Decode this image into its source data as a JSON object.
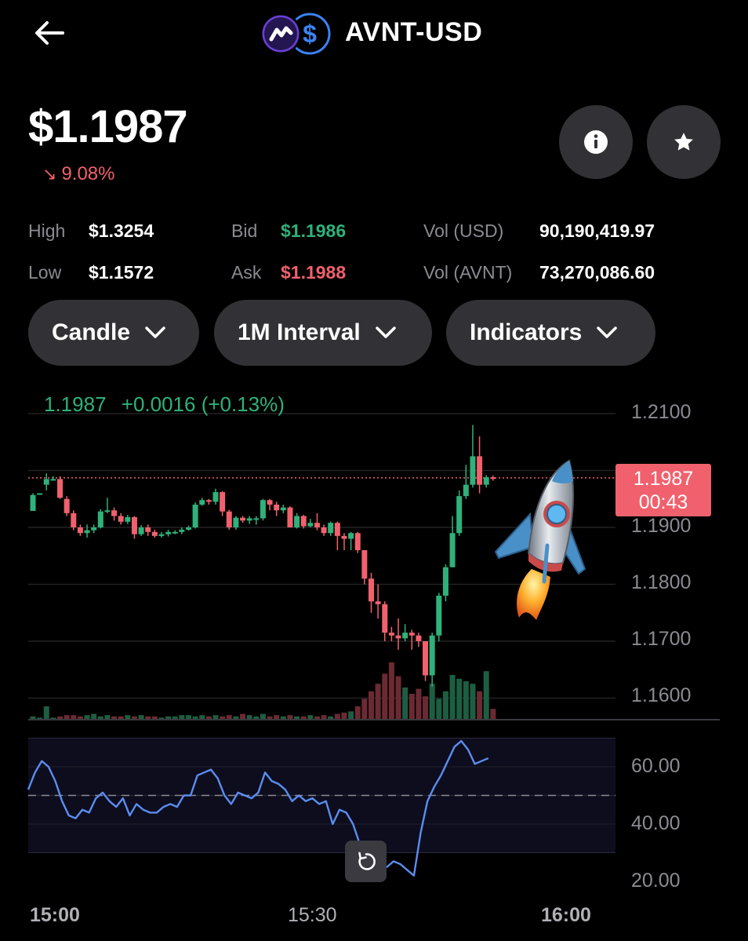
{
  "header": {
    "back_icon": "back-arrow-icon",
    "pair_title": "AVNT-USD",
    "base_icon": "avnt-logo-icon",
    "quote_icon": "usd-logo-icon"
  },
  "price": {
    "value": "$1.1987",
    "change": "9.08%",
    "change_direction_icon": "arrow-down-right-icon",
    "change_color": "#f0616d"
  },
  "actions": {
    "info_icon": "info-icon",
    "favorite_icon": "star-icon"
  },
  "stats": {
    "high_label": "High",
    "high_value": "$1.3254",
    "low_label": "Low",
    "low_value": "$1.1572",
    "bid_label": "Bid",
    "bid_value": "$1.1986",
    "ask_label": "Ask",
    "ask_value": "$1.1988",
    "vol_usd_label": "Vol (USD)",
    "vol_usd_value": "90,190,419.97",
    "vol_avnt_label": "Vol (AVNT)",
    "vol_avnt_value": "73,270,086.60"
  },
  "controls": {
    "chart_type": "Candle",
    "interval": "1M Interval",
    "indicators": "Indicators"
  },
  "chart": {
    "readout_price": "1.1987",
    "readout_change": "+0.0016 (+0.13%)",
    "price_tag_value": "1.1987",
    "price_tag_timer": "00:43",
    "price_axis": [
      "1.2100",
      "1.1900",
      "1.1800",
      "1.1700",
      "1.1600"
    ],
    "rsi_axis": [
      "60.00",
      "40.00",
      "20.00"
    ],
    "time_axis": [
      "15:00",
      "15:30",
      "16:00"
    ],
    "up_color": "#2fb17a",
    "down_color": "#f0616d",
    "rsi_color": "#5b8def",
    "reset_icon": "reset-icon",
    "sticker": "rocket-emoji"
  },
  "chart_data": {
    "type": "candlestick",
    "interval": "1 minute",
    "x_range": [
      "15:00",
      "16:00"
    ],
    "ylim": [
      1.16,
      1.21
    ],
    "last_price": 1.1987,
    "candles_ohlc": [
      [
        1.1929,
        1.1957,
        1.1929,
        1.196
      ],
      [
        1.196,
        1.196,
        1.197,
        1.197
      ],
      [
        1.1975,
        1.1985,
        1.1965,
        1.1995
      ],
      [
        1.1985,
        1.1985,
        1.1985,
        1.199
      ],
      [
        1.1985,
        1.1952,
        1.195,
        1.199
      ],
      [
        1.195,
        1.1925,
        1.192,
        1.1955
      ],
      [
        1.1925,
        1.19,
        1.1895,
        1.193
      ],
      [
        1.19,
        1.189,
        1.1885,
        1.1905
      ],
      [
        1.189,
        1.1895,
        1.1882,
        1.1905
      ],
      [
        1.1895,
        1.19,
        1.189,
        1.1905
      ],
      [
        1.19,
        1.1928,
        1.1898,
        1.1932
      ],
      [
        1.1928,
        1.193,
        1.1925,
        1.1952
      ],
      [
        1.193,
        1.192,
        1.1912,
        1.1935
      ],
      [
        1.192,
        1.191,
        1.1905,
        1.1925
      ],
      [
        1.191,
        1.1918,
        1.1906,
        1.1922
      ],
      [
        1.1918,
        1.1888,
        1.188,
        1.192
      ],
      [
        1.1888,
        1.19,
        1.1885,
        1.1904
      ],
      [
        1.19,
        1.1892,
        1.1885,
        1.1905
      ],
      [
        1.1892,
        1.1885,
        1.1882,
        1.1896
      ],
      [
        1.1885,
        1.1888,
        1.1882,
        1.1892
      ],
      [
        1.1888,
        1.1892,
        1.1884,
        1.1896
      ],
      [
        1.1892,
        1.1892,
        1.1888,
        1.1895
      ],
      [
        1.1892,
        1.1896,
        1.1888,
        1.19
      ],
      [
        1.1896,
        1.19,
        1.1894,
        1.1903
      ],
      [
        1.19,
        1.194,
        1.1898,
        1.1944
      ],
      [
        1.194,
        1.1948,
        1.1938,
        1.1952
      ],
      [
        1.1948,
        1.1945,
        1.194,
        1.195
      ],
      [
        1.1945,
        1.1962,
        1.194,
        1.1968
      ],
      [
        1.1962,
        1.1928,
        1.192,
        1.1964
      ],
      [
        1.1928,
        1.19,
        1.1896,
        1.1931
      ],
      [
        1.19,
        1.1917,
        1.1896,
        1.192
      ],
      [
        1.1917,
        1.1912,
        1.1908,
        1.192
      ],
      [
        1.1912,
        1.1916,
        1.1906,
        1.192
      ],
      [
        1.1916,
        1.1916,
        1.1905,
        1.192
      ],
      [
        1.1916,
        1.1948,
        1.1912,
        1.195
      ],
      [
        1.1948,
        1.194,
        1.193,
        1.195
      ],
      [
        1.194,
        1.193,
        1.192,
        1.1945
      ],
      [
        1.193,
        1.1935,
        1.1925,
        1.194
      ],
      [
        1.1935,
        1.19,
        1.19,
        1.1937
      ],
      [
        1.19,
        1.192,
        1.1898,
        1.1925
      ],
      [
        1.192,
        1.1902,
        1.1898,
        1.1922
      ],
      [
        1.1902,
        1.1908,
        1.19,
        1.1915
      ],
      [
        1.1908,
        1.19,
        1.1895,
        1.1925
      ],
      [
        1.19,
        1.189,
        1.1885,
        1.1905
      ],
      [
        1.189,
        1.1908,
        1.1885,
        1.191
      ],
      [
        1.1908,
        1.1885,
        1.186,
        1.191
      ],
      [
        1.1885,
        1.188,
        1.186,
        1.189
      ],
      [
        1.188,
        1.189,
        1.186,
        1.1892
      ],
      [
        1.189,
        1.186,
        1.1855,
        1.1892
      ],
      [
        1.186,
        1.181,
        1.18,
        1.186
      ],
      [
        1.181,
        1.177,
        1.175,
        1.182
      ],
      [
        1.177,
        1.1765,
        1.174,
        1.18
      ],
      [
        1.1765,
        1.1715,
        1.17,
        1.177
      ],
      [
        1.1715,
        1.171,
        1.17,
        1.1725
      ],
      [
        1.171,
        1.1705,
        1.1685,
        1.174
      ],
      [
        1.1705,
        1.1715,
        1.17,
        1.173
      ],
      [
        1.1715,
        1.171,
        1.1685,
        1.172
      ],
      [
        1.171,
        1.17,
        1.169,
        1.1715
      ],
      [
        1.17,
        1.164,
        1.163,
        1.17
      ],
      [
        1.164,
        1.171,
        1.162,
        1.1715
      ],
      [
        1.171,
        1.178,
        1.17,
        1.1785
      ],
      [
        1.178,
        1.183,
        1.177,
        1.1835
      ],
      [
        1.183,
        1.189,
        1.183,
        1.192
      ],
      [
        1.189,
        1.1955,
        1.1885,
        1.1965
      ],
      [
        1.1955,
        1.1975,
        1.195,
        1.201
      ],
      [
        1.1975,
        1.2025,
        1.197,
        1.208
      ],
      [
        1.2025,
        1.1975,
        1.196,
        1.206
      ],
      [
        1.1975,
        1.1988,
        1.197,
        1.1992
      ],
      [
        1.1988,
        1.1987,
        1.1982,
        1.1991
      ]
    ],
    "volume_relative": [
      2,
      1,
      10,
      1,
      2,
      3,
      3,
      2,
      3,
      4,
      2,
      3,
      2,
      2,
      3,
      2,
      3,
      2,
      2,
      1,
      2,
      2,
      3,
      3,
      2,
      3,
      2,
      3,
      2,
      3,
      2,
      4,
      3,
      2,
      4,
      2,
      3,
      2,
      3,
      2,
      2,
      3,
      2,
      3,
      2,
      4,
      5,
      6,
      10,
      16,
      22,
      28,
      36,
      45,
      34,
      25,
      20,
      24,
      18,
      28,
      16,
      22,
      35,
      32,
      30,
      28,
      22,
      38,
      8
    ],
    "rsi": {
      "ylim": [
        20,
        70
      ],
      "levels": [
        30,
        50,
        70
      ],
      "values": [
        52,
        58,
        62,
        60,
        55,
        48,
        43,
        42,
        45,
        44,
        49,
        51,
        48,
        46,
        49,
        43,
        47,
        45,
        44,
        44,
        46,
        47,
        46,
        50,
        50,
        57,
        58,
        59,
        56,
        50,
        47,
        51,
        50,
        49,
        51,
        58,
        55,
        54,
        52,
        48,
        50,
        48,
        49,
        47,
        48,
        40,
        45,
        44,
        40,
        33,
        27,
        24,
        26,
        25,
        27,
        26,
        24,
        22,
        37,
        48,
        53,
        57,
        62,
        67,
        69,
        66,
        61,
        62,
        63
      ]
    }
  }
}
